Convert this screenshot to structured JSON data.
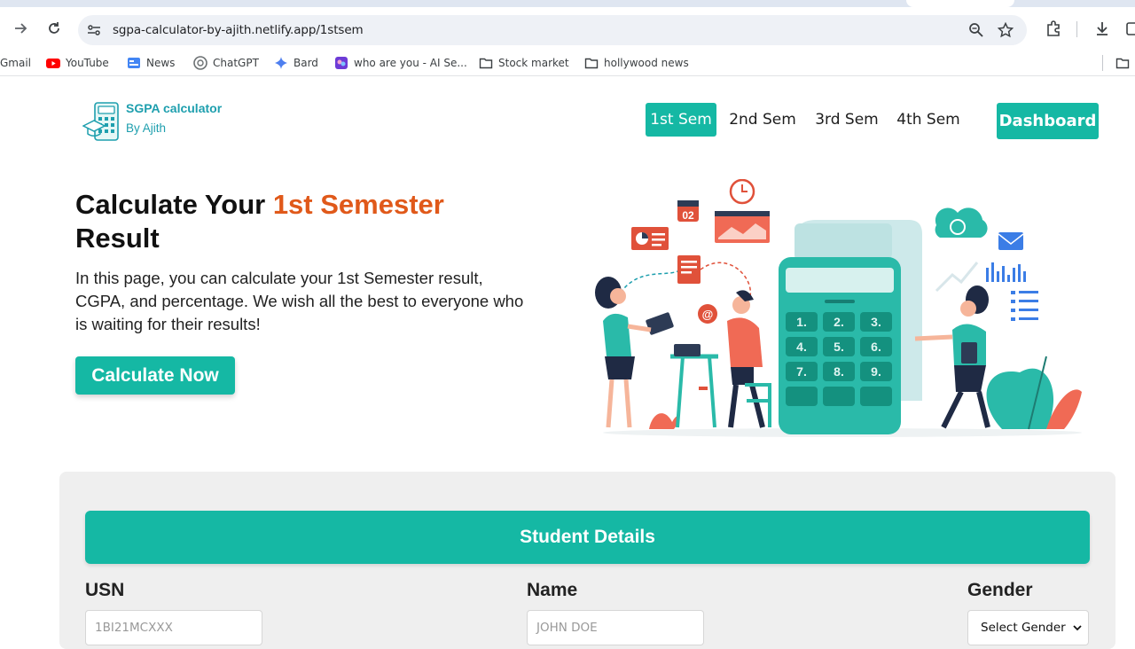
{
  "browser": {
    "url": "sgpa-calculator-by-ajith.netlify.app/1stsem",
    "bookmarks": [
      "Gmail",
      "YouTube",
      "News",
      "ChatGPT",
      "Bard",
      "who are you - AI Se...",
      "Stock market",
      "hollywood news"
    ]
  },
  "brand": {
    "title": "SGPA calculator",
    "subtitle": "By Ajith"
  },
  "nav": {
    "items": [
      "1st Sem",
      "2nd Sem",
      "3rd Sem",
      "4th Sem"
    ],
    "active": "1st Sem",
    "dashboard": "Dashboard"
  },
  "hero": {
    "title_prefix": "Calculate Your ",
    "title_accent": "1st Semester",
    "title_suffix": "Result",
    "description": "In this page, you can calculate your 1st Semester result, CGPA, and percentage. We wish all the best to everyone who is waiting for their results!",
    "cta": "Calculate Now"
  },
  "illustration": {
    "date_badge": "02",
    "keys": [
      "1.",
      "2.",
      "3.",
      "4.",
      "5.",
      "6.",
      "7.",
      "8.",
      "9."
    ]
  },
  "student_details": {
    "header": "Student Details",
    "usn_label": "USN",
    "usn_placeholder": "1BI21MCXXX",
    "name_label": "Name",
    "name_placeholder": "JOHN DOE",
    "gender_label": "Gender",
    "gender_value": "Select Gender"
  },
  "colors": {
    "primary": "#15b8a4",
    "accent": "#e0591a",
    "brand_text": "#1e9fae"
  }
}
